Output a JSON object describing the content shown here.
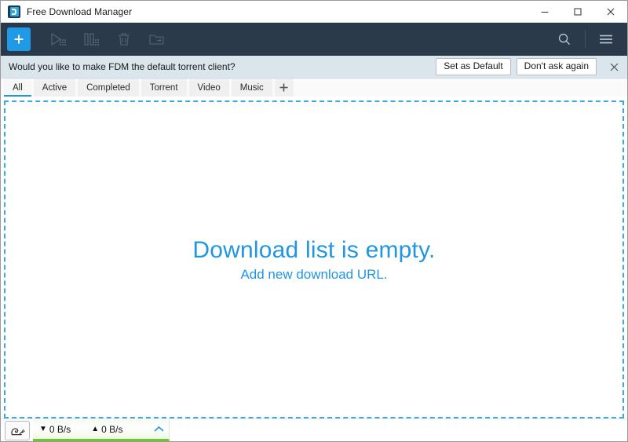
{
  "window": {
    "title": "Free Download Manager",
    "icon": "fdm-app-icon",
    "controls": {
      "minimize": "minimize-icon",
      "maximize": "maximize-icon",
      "close": "close-icon"
    }
  },
  "toolbar": {
    "add_label": "+",
    "add_icon": "plus-icon",
    "buttons": [
      {
        "name": "start-all-button",
        "icon": "play-all-icon",
        "enabled": false
      },
      {
        "name": "pause-all-button",
        "icon": "pause-all-icon",
        "enabled": false
      },
      {
        "name": "delete-button",
        "icon": "trash-icon",
        "enabled": false
      },
      {
        "name": "open-folder-button",
        "icon": "folder-open-icon",
        "enabled": false
      }
    ],
    "search_icon": "search-icon",
    "menu_icon": "hamburger-menu-icon",
    "background_color": "#2b3a4a",
    "accent_color": "#1e9ae6"
  },
  "notification": {
    "message": "Would you like to make FDM the default torrent client?",
    "primary_button": "Set as Default",
    "secondary_button": "Don't ask again",
    "close_icon": "close-icon",
    "background_color": "#dbe5ec"
  },
  "tabs": {
    "items": [
      {
        "label": "All",
        "active": true
      },
      {
        "label": "Active",
        "active": false
      },
      {
        "label": "Completed",
        "active": false
      },
      {
        "label": "Torrent",
        "active": false
      },
      {
        "label": "Video",
        "active": false
      },
      {
        "label": "Music",
        "active": false
      }
    ],
    "add_tab_icon": "plus-icon",
    "active_underline_color": "#2196d9"
  },
  "main": {
    "empty_title": "Download list is empty.",
    "empty_subtitle": "Add new download URL.",
    "dropzone_border_color": "#3aa9e0",
    "text_color": "#2196e3"
  },
  "statusbar": {
    "speed_limit_icon": "snail-icon",
    "download_arrow": "▼",
    "download_speed": "0 B/s",
    "upload_arrow": "▲",
    "upload_speed": "0 B/s",
    "expand_icon": "chevron-up-icon",
    "accent_color": "#6fc52c"
  }
}
